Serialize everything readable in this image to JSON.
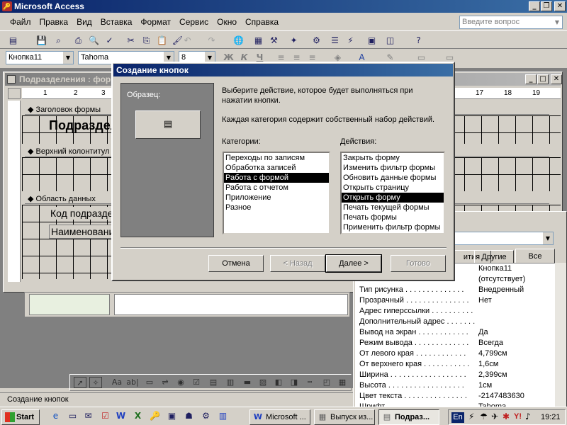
{
  "app": {
    "title": "Microsoft Access"
  },
  "menu": [
    "Файл",
    "Правка",
    "Вид",
    "Вставка",
    "Формат",
    "Сервис",
    "Окно",
    "Справка"
  ],
  "help_box": {
    "placeholder": "Введите вопрос"
  },
  "format_bar": {
    "object": "Кнопка11",
    "font": "Tahoma",
    "size": "8",
    "bold": "Ж",
    "italic": "К",
    "underline": "Ч"
  },
  "form_window": {
    "title": "Подразделения : форма",
    "ruler_numbers": [
      "1",
      "2",
      "3"
    ],
    "ruler_numbers_right": [
      "17",
      "18",
      "19"
    ],
    "sections": {
      "header": "Заголовок формы",
      "page_header": "Верхний колонтитул",
      "detail": "Область данных"
    },
    "header_label": "Подразделения",
    "field1": "Код подразделения",
    "field2": "Наименование"
  },
  "wizard": {
    "title": "Создание кнопок",
    "sample_label": "Образец:",
    "instruction1": "Выберите действие, которое будет выполняться при нажатии кнопки.",
    "instruction2": "Каждая категория содержит собственный набор действий.",
    "categories_label": "Категории:",
    "actions_label": "Действия:",
    "categories": [
      {
        "label": "Переходы по записям",
        "selected": false
      },
      {
        "label": "Обработка записей",
        "selected": false
      },
      {
        "label": "Работа с формой",
        "selected": true
      },
      {
        "label": "Работа с отчетом",
        "selected": false
      },
      {
        "label": "Приложение",
        "selected": false
      },
      {
        "label": "Разное",
        "selected": false
      }
    ],
    "actions": [
      {
        "label": "Закрыть форму",
        "selected": false
      },
      {
        "label": "Изменить фильтр формы",
        "selected": false
      },
      {
        "label": "Обновить данные формы",
        "selected": false
      },
      {
        "label": "Открыть страницу",
        "selected": false
      },
      {
        "label": "Открыть форму",
        "selected": true
      },
      {
        "label": "Печать текущей формы",
        "selected": false
      },
      {
        "label": "Печать формы",
        "selected": false
      },
      {
        "label": "Применить фильтр формы",
        "selected": false
      }
    ],
    "buttons": {
      "cancel": "Отмена",
      "back": "< Назад",
      "next": "Далее >",
      "finish": "Готово"
    }
  },
  "properties": {
    "tabs": {
      "partial": "ития",
      "other": "Другие",
      "all": "Все"
    },
    "rows": [
      {
        "name": ". . . . . . . . . . . . . .",
        "value": "Кнопка11"
      },
      {
        "name": ". . . . . . . . . . . . . .",
        "value": "(отсутствует)"
      },
      {
        "name": "Тип рисунка . . . . . . . . . . . . . .",
        "value": "Внедренный"
      },
      {
        "name": "Прозрачный . . . . . . . . . . . . . . .",
        "value": "Нет"
      },
      {
        "name": "Адрес гиперссылки . . . . . . . . . .",
        "value": ""
      },
      {
        "name": "Дополнительный адрес . . . . . . .",
        "value": ""
      },
      {
        "name": "Вывод на экран . . . . . . . . . . . .",
        "value": "Да"
      },
      {
        "name": "Режим вывода . . . . . . . . . . . . .",
        "value": "Всегда"
      },
      {
        "name": "От левого края . . . . . . . . . . . .",
        "value": "4,799см"
      },
      {
        "name": "От верхнего края . . . . . . . . . . .",
        "value": "1,6см"
      },
      {
        "name": "Ширина . . . . . . . . . . . . . . . . . .",
        "value": "2,399см"
      },
      {
        "name": "Высота . . . . . . . . . . . . . . . . . .",
        "value": "1см"
      },
      {
        "name": "Цвет текста . . . . . . . . . . . . . . .",
        "value": "-2147483630"
      },
      {
        "name": "Шрифт . . . . . . . . . . . . . . . . . .",
        "value": "Tahoma"
      }
    ]
  },
  "status": {
    "text": "Создание кнопок"
  },
  "taskbar": {
    "start": "Start",
    "tasks": [
      {
        "label": "Microsoft ...",
        "active": false
      },
      {
        "label": "Выпуск из...",
        "active": false
      },
      {
        "label": "Подраз...",
        "active": true
      }
    ],
    "lang": "En",
    "clock": "19:21"
  },
  "colors": {
    "title_active": "#0a246a",
    "selection": "#000000",
    "face": "#d4d0c8"
  }
}
